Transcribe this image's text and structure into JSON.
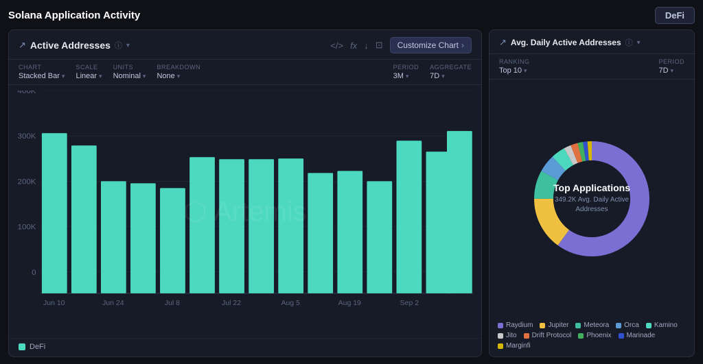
{
  "app": {
    "title": "Solana Application Activity",
    "defi_badge": "DeFi"
  },
  "left_panel": {
    "title": "Active Addresses",
    "header_actions": {
      "code_icon": "</>",
      "fx_icon": "fx",
      "download_icon": "↓",
      "camera_icon": "◷",
      "customize_label": "Customize Chart"
    },
    "toolbar": {
      "chart_label": "CHART",
      "chart_value": "Stacked Bar",
      "scale_label": "SCALE",
      "scale_value": "Linear",
      "units_label": "UNITS",
      "units_value": "Nominal",
      "breakdown_label": "BREAKDOWN",
      "breakdown_value": "None",
      "period_label": "PERIOD",
      "period_value": "3M",
      "aggregate_label": "AGGREGATE",
      "aggregate_value": "7D"
    },
    "legend": {
      "color": "#4dd9c0",
      "label": "DeFi"
    },
    "bars": [
      {
        "x": 0,
        "h": 0.87,
        "label": "Jun 10"
      },
      {
        "x": 1,
        "h": 0.82,
        "label": ""
      },
      {
        "x": 2,
        "h": 0.62,
        "label": "Jun 24"
      },
      {
        "x": 3,
        "h": 0.61,
        "label": ""
      },
      {
        "x": 4,
        "h": 0.58,
        "label": "Jul 8"
      },
      {
        "x": 5,
        "h": 0.75,
        "label": ""
      },
      {
        "x": 6,
        "h": 0.73,
        "label": "Jul 22"
      },
      {
        "x": 7,
        "h": 0.73,
        "label": ""
      },
      {
        "x": 8,
        "h": 0.74,
        "label": "Aug 5"
      },
      {
        "x": 9,
        "h": 0.65,
        "label": ""
      },
      {
        "x": 10,
        "h": 0.67,
        "label": "Aug 19"
      },
      {
        "x": 11,
        "h": 0.62,
        "label": ""
      },
      {
        "x": 12,
        "h": 0.84,
        "label": "Sep 2"
      },
      {
        "x": 13,
        "h": 0.78,
        "label": ""
      },
      {
        "x": 14,
        "h": 0.88,
        "label": ""
      }
    ],
    "y_labels": [
      "400K",
      "300K",
      "200K",
      "100K",
      "0"
    ],
    "x_labels": [
      "Jun 10",
      "Jun 24",
      "Jul 8",
      "Jul 22",
      "Aug 5",
      "Aug 19",
      "Sep 2"
    ]
  },
  "right_panel": {
    "title": "Avg. Daily Active Addresses",
    "ranking_label": "RANKING",
    "ranking_value": "Top 10",
    "period_label": "PERIOD",
    "period_value": "7D",
    "donut": {
      "center_title": "Top Applications",
      "center_subtitle": "349.2K Avg. Daily Active\nAddresses"
    },
    "legend_items": [
      {
        "color": "#7c6fd4",
        "label": "Raydium"
      },
      {
        "color": "#f0c040",
        "label": "Jupiter"
      },
      {
        "color": "#3dbfa0",
        "label": "Meteora"
      },
      {
        "color": "#5b9bd5",
        "label": "Orca"
      },
      {
        "color": "#4dd9c0",
        "label": "Kamino"
      },
      {
        "color": "#c8c8c8",
        "label": "Jito"
      },
      {
        "color": "#e07040",
        "label": "Drift Protocol"
      },
      {
        "color": "#40b060",
        "label": "Phoenix"
      },
      {
        "color": "#3050d0",
        "label": "Marinade"
      },
      {
        "color": "#d4b800",
        "label": "Marginfi"
      }
    ]
  }
}
